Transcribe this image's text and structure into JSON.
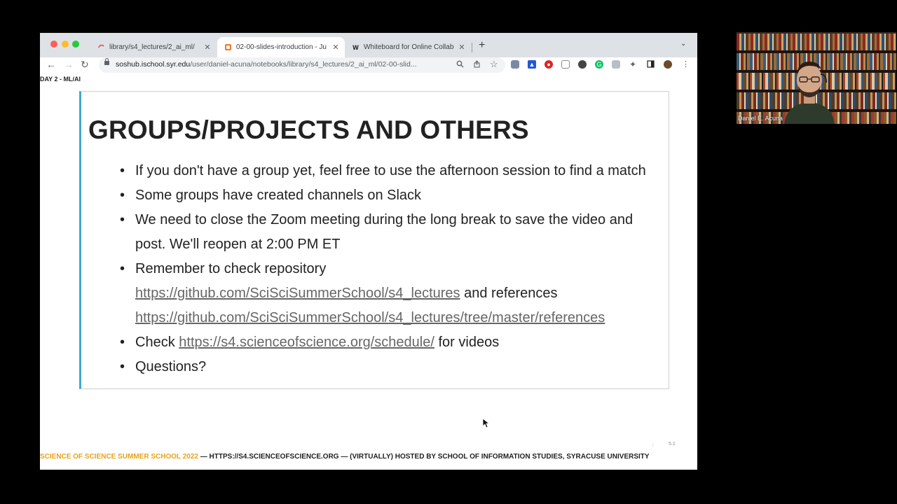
{
  "browser": {
    "tabs": [
      {
        "label": "library/s4_lectures/2_ai_ml/",
        "icon": "loading-icon",
        "active": false
      },
      {
        "label": "02-00-slides-introduction - Ju",
        "icon": "jupyter-icon",
        "active": true
      },
      {
        "label": "Whiteboard for Online Collabo",
        "icon": "w-icon",
        "active": false
      }
    ],
    "url_host": "soshub.ischool.syr.edu",
    "url_path": "/user/daniel-acuna/notebooks/library/s4_lectures/2_ai_ml/02-00-slid..."
  },
  "slide": {
    "day_label": "DAY 2 - ML/AI",
    "title": "GROUPS/PROJECTS AND OTHERS",
    "bullet1": "If you don't have a group yet, feel free to use the afternoon session to find a match",
    "bullet2": "Some groups have created channels on Slack",
    "bullet3": "We need to close the Zoom meeting during the long break to save the video and post. We'll reopen at 2:00 PM ET",
    "bullet4_prefix": "Remember to check repository",
    "bullet4_link1": "https://github.com/SciSciSummerSchool/s4_lectures",
    "bullet4_mid": "and references",
    "bullet4_link2": "https://github.com/SciSciSummerSchool/s4_lectures/tree/master/references",
    "bullet5_prefix": "Check",
    "bullet5_link": "https://s4.scienceofscience.org/schedule/",
    "bullet5_suffix": "for videos",
    "bullet6": "Questions?",
    "slide_number": "5.1",
    "footer_school": "SCIENCE OF SCIENCE SUMMER SCHOOL 2022",
    "footer_rest": " — HTTPS://S4.SCIENCEOFSCIENCE.ORG — (VIRTUALLY) HOSTED BY SCHOOL OF INFORMATION STUDIES, SYRACUSE UNIVERSITY"
  },
  "webcam": {
    "name": "Daniel E. Acuna"
  },
  "colors": {
    "accent_bar": "#3fa9d0",
    "footer_school": "#e8a317"
  }
}
